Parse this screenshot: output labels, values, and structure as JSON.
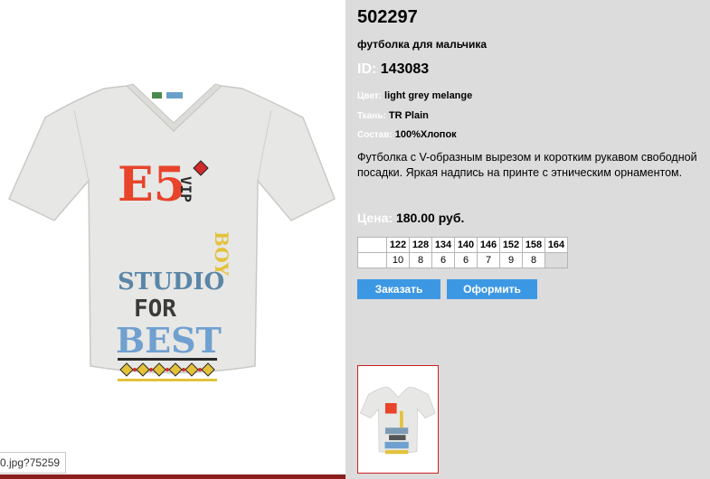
{
  "status_url": "0.jpg?75259",
  "product": {
    "article": "502297",
    "subtitle": "футболка для мальчика",
    "id_label": "ID:",
    "id_value": "143083",
    "color_label": "Цвет:",
    "color_value": "light grey melange",
    "fabric_label": "Ткань:",
    "fabric_value": "TR Plain",
    "composition_label": "Состав:",
    "composition_value": "100%Хлопок",
    "description": "Футболка с V-образным вырезом и коротким рукавом свободной посадки. Яркая надпись на принте с этническим орнаментом.",
    "price_label": "Цена:",
    "price_value": "180.00 руб."
  },
  "sizes": {
    "headers": [
      "122",
      "128",
      "134",
      "140",
      "146",
      "152",
      "158",
      "164"
    ],
    "quantities": [
      "10",
      "8",
      "6",
      "6",
      "7",
      "9",
      "8",
      ""
    ]
  },
  "buttons": {
    "order": "Заказать",
    "checkout": "Оформить"
  },
  "print_text": {
    "line1": "E5",
    "line2": "VIP",
    "line3": "STUDIO",
    "line4": "FOR",
    "line5": "BEST",
    "line6": "BOY"
  },
  "colors": {
    "shirt": "#e7e7e5",
    "panel_bg": "#dcdcdc",
    "button": "#3d98e4",
    "label_white": "#ffffff"
  }
}
